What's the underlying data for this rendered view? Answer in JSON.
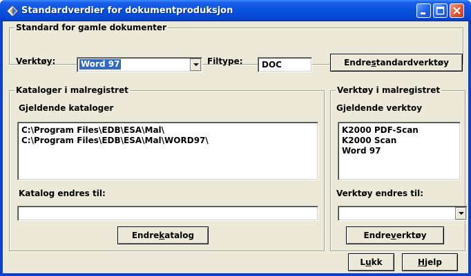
{
  "window": {
    "title": "Standardverdier for dokumentproduksjon"
  },
  "standard_group": {
    "label": "Standard for gamle dokumenter",
    "tool_label": "Verktøy:",
    "tool_value": "Word 97",
    "filetype_label": "Filtype:",
    "filetype_value": "DOC",
    "change_default_pre": "Endre ",
    "change_default_key": "s",
    "change_default_post": "tandardverktøy"
  },
  "catalog_group": {
    "label": "Kataloger i malregistret",
    "current_label": "Gjeldende kataloger",
    "items": [
      "C:\\Program Files\\EDB\\ESA\\Mal\\",
      "C:\\Program Files\\EDB\\ESA\\Mal\\WORD97\\"
    ],
    "change_to_label": "Katalog endres til:",
    "change_to_value": "",
    "button_pre": "Endre ",
    "button_key": "k",
    "button_post": "atalog"
  },
  "tools_group": {
    "label": "Verktøy i malregistret",
    "current_label": "Gjeldende verktoy",
    "items": [
      "K2000 PDF-Scan",
      "K2000 Scan",
      "Word 97"
    ],
    "change_to_label": "Verktøy endres til:",
    "change_to_value": "",
    "button_pre": "Endre ",
    "button_key": "v",
    "button_post": "erktøy"
  },
  "footer": {
    "close_pre": "L",
    "close_key": "u",
    "close_post": "kk",
    "help_pre": "",
    "help_key": "H",
    "help_post": "jelp"
  },
  "colors": {
    "titlebar": "#0752e0",
    "face": "#ece9d8",
    "selection": "#316ac5"
  }
}
